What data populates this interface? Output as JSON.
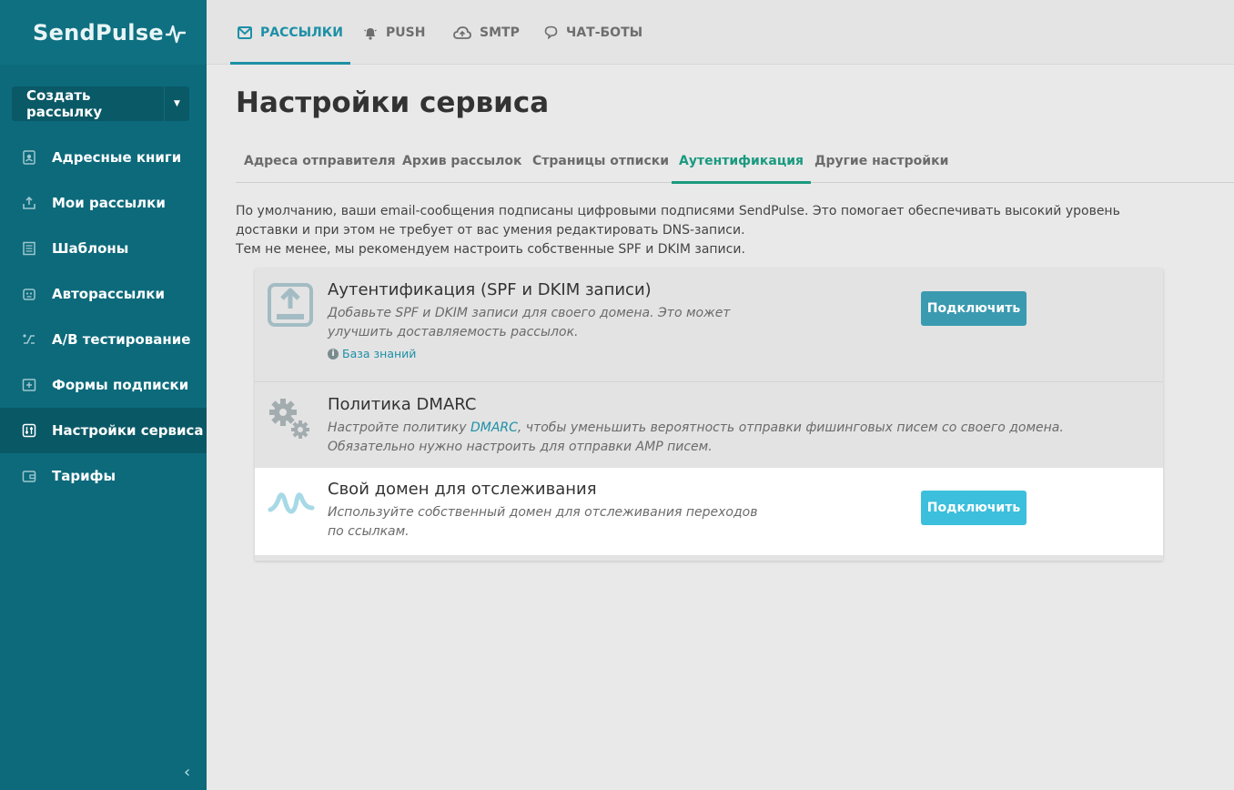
{
  "brand": {
    "logo_text": "SendPulse"
  },
  "sidebar": {
    "create_button": "Создать рассылку",
    "items": [
      {
        "label": "Адресные книги",
        "icon": "address-book-icon"
      },
      {
        "label": "Мои рассылки",
        "icon": "upload-icon"
      },
      {
        "label": "Шаблоны",
        "icon": "template-icon"
      },
      {
        "label": "Авторассылки",
        "icon": "robot-icon"
      },
      {
        "label": "A/B тестирование",
        "icon": "split-icon"
      },
      {
        "label": "Формы подписки",
        "icon": "form-icon"
      },
      {
        "label": "Настройки сервиса",
        "icon": "sliders-icon",
        "active": true
      },
      {
        "label": "Тарифы",
        "icon": "wallet-icon"
      }
    ],
    "collapse_glyph": "‹"
  },
  "topbar": {
    "tabs": [
      {
        "label": "РАССЫЛКИ",
        "icon": "mail-icon",
        "active": true
      },
      {
        "label": "PUSH",
        "icon": "bell-icon"
      },
      {
        "label": "SMTP",
        "icon": "cloud-upload-icon"
      },
      {
        "label": "ЧАТ-БОТЫ",
        "icon": "chat-icon"
      }
    ]
  },
  "page": {
    "title": "Настройки сервиса",
    "subtabs": [
      {
        "label": "Адреса отправителя"
      },
      {
        "label": "Архив рассылок"
      },
      {
        "label": "Страницы отписки"
      },
      {
        "label": "Аутентификация",
        "active": true
      },
      {
        "label": "Другие настройки"
      }
    ],
    "intro_line1": "По умолчанию, ваши email-сообщения подписаны цифровыми подписями SendPulse. Это помогает обеспечивать высокий уровень доставки и при этом не требует от вас умения редактировать DNS-записи.",
    "intro_line2": "Тем не менее, мы рекомендуем настроить собственные SPF и DKIM записи."
  },
  "cards": {
    "auth": {
      "title": "Аутентификация (SPF и DKIM записи)",
      "desc": "Добавьте SPF и DKIM записи для своего домена. Это может улучшить доставляемость рассылок.",
      "kb_link": "База знаний",
      "button": "Подключить",
      "icon": "upload-box-icon"
    },
    "dmarc": {
      "title": "Политика DMARC",
      "desc_before": "Настройте политику ",
      "desc_link": "DMARC",
      "desc_after": ", чтобы уменьшить вероятность отправки фишинговых писем со своего домена.",
      "desc_line2": "Обязательно нужно настроить для отправки AMP писем.",
      "icon": "gears-icon"
    },
    "tracking": {
      "title": "Свой домен для отслеживания",
      "desc": "Используйте собственный домен для отслеживания переходов по ссылкам.",
      "button": "Подключить",
      "icon": "pulse-wave-icon"
    }
  },
  "colors": {
    "sidebar_bg": "#0c6a7b",
    "accent": "#1d90a6",
    "active_tab": "#1a9a7f",
    "button_bright": "#3cbfdc"
  }
}
